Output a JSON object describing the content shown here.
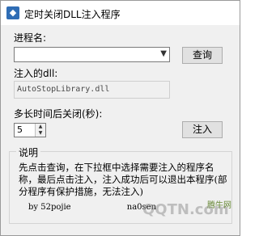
{
  "window": {
    "title": "定时关闭DLL注入程序",
    "app_icon": "dll-app-icon"
  },
  "form": {
    "process_label": "进程名:",
    "process_value": "",
    "query_button": "查询",
    "dll_label": "注入的dll:",
    "dll_value": "AutoStopLibrary.dll",
    "time_label": "多长时间后关闭(秒):",
    "time_value": "5",
    "inject_button": "注入"
  },
  "info": {
    "group_title": "说明",
    "description": "先点击查询，在下拉框中选择需要注入的程序名称，最后点击注入，注入成功后可以退出本程序(部分程序有保护措施，无法注入)",
    "byline": "by 52pojie",
    "byline_tail": "na0sen"
  },
  "watermark": {
    "text": "QQTN.com",
    "logo": "腾牛网"
  }
}
